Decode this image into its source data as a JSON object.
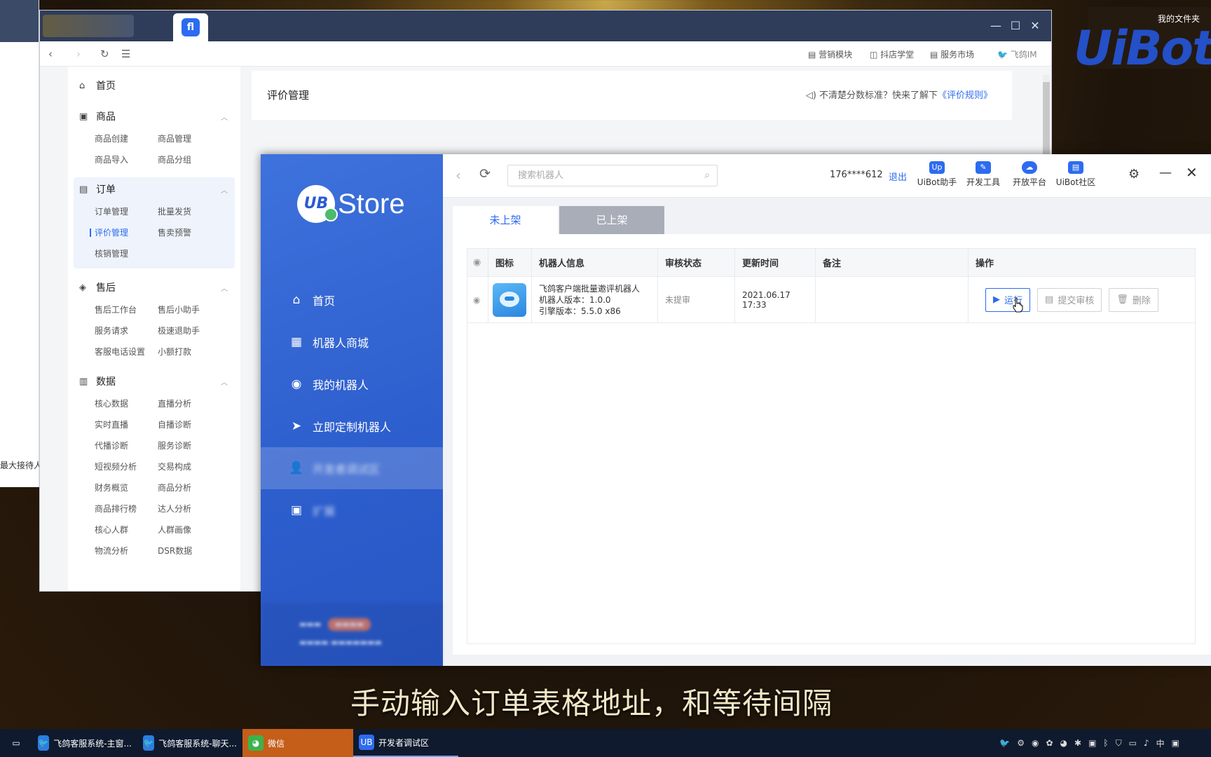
{
  "back_window": {
    "clipped_text": "最大接待人"
  },
  "douyin": {
    "toolbar": {
      "marketing": "营销模块",
      "school": "抖店学堂",
      "market": "服务市场",
      "im": "飞鸽IM"
    },
    "sidebar": {
      "home": "首页",
      "goods": {
        "title": "商品",
        "items": [
          "商品创建",
          "商品管理",
          "商品导入",
          "商品分组"
        ]
      },
      "orders": {
        "title": "订单",
        "items": [
          "订单管理",
          "批量发货",
          "评价管理",
          "售卖预警",
          "核销管理"
        ]
      },
      "aftersale": {
        "title": "售后",
        "items": [
          "售后工作台",
          "售后小助手",
          "服务请求",
          "极速退助手",
          "客服电话设置",
          "小额打款"
        ]
      },
      "data": {
        "title": "数据",
        "items": [
          "核心数据",
          "直播分析",
          "实时直播",
          "自播诊断",
          "代播诊断",
          "服务诊断",
          "短视频分析",
          "交易构成",
          "财务概览",
          "商品分析",
          "商品排行榜",
          "达人分析",
          "核心人群",
          "人群画像",
          "物流分析",
          "DSR数据"
        ]
      }
    },
    "main": {
      "title": "评价管理",
      "rule_text": "不清楚分数标准？快来了解下",
      "rule_link": "《评价规则》"
    }
  },
  "desktop": {
    "files_label": "我的文件夹",
    "logo": "UiBot"
  },
  "store": {
    "logo_text": "Store",
    "nav": [
      "首页",
      "机器人商城",
      "我的机器人",
      "立即定制机器人",
      "开发者调试区",
      "扩展"
    ],
    "search_placeholder": "搜索机器人",
    "user": "176****612",
    "logout": "退出",
    "tools": [
      "UiBot助手",
      "开发工具",
      "开放平台",
      "UiBot社区"
    ],
    "tabs": [
      "未上架",
      "已上架"
    ],
    "table": {
      "headers": [
        "图标",
        "机器人信息",
        "审核状态",
        "更新时间",
        "备注",
        "操作"
      ],
      "rows": [
        {
          "name": "飞鸽客户端批量邀评机器人",
          "version": "机器人版本：1.0.0",
          "engine": "引擎版本：5.5.0 x86",
          "status": "未提审",
          "updated": "2021.06.17 17:33",
          "remark": ""
        }
      ],
      "actions": [
        "运行",
        "提交审核",
        "删除"
      ]
    }
  },
  "subtitle": "手动输入订单表格地址，和等待间隔",
  "taskbar": {
    "items": [
      "飞鸽客服系统-主窗...",
      "飞鸽客服系统-聊天...",
      "微信",
      "开发者调试区"
    ],
    "ime": "中"
  },
  "colors": {
    "accent": "#2d6bf0",
    "store_sidebar": "#2e5fce",
    "taskbar": "#0f1a2e"
  }
}
